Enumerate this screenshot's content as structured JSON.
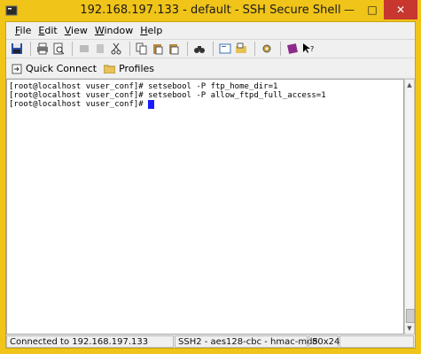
{
  "window": {
    "title": "192.168.197.133 - default - SSH Secure Shell"
  },
  "menu": [
    {
      "key": "F",
      "rest": "ile"
    },
    {
      "key": "E",
      "rest": "dit"
    },
    {
      "key": "V",
      "rest": "iew"
    },
    {
      "key": "W",
      "rest": "indow"
    },
    {
      "key": "H",
      "rest": "elp"
    }
  ],
  "quickbar": {
    "quick_connect": "Quick Connect",
    "profiles": "Profiles"
  },
  "terminal": {
    "lines": [
      "[root@localhost vuser_conf]# setsebool -P ftp_home_dir=1",
      "[root@localhost vuser_conf]# setsebool -P allow_ftpd_full_access=1",
      "[root@localhost vuser_conf]# "
    ]
  },
  "status": {
    "connection": "Connected to 192.168.197.133",
    "encryption": "SSH2 - aes128-cbc - hmac-md5",
    "size": "80x24"
  },
  "colors": {
    "frame": "#f0c419",
    "cursor": "#1a1aff",
    "close": "#c7372f"
  }
}
